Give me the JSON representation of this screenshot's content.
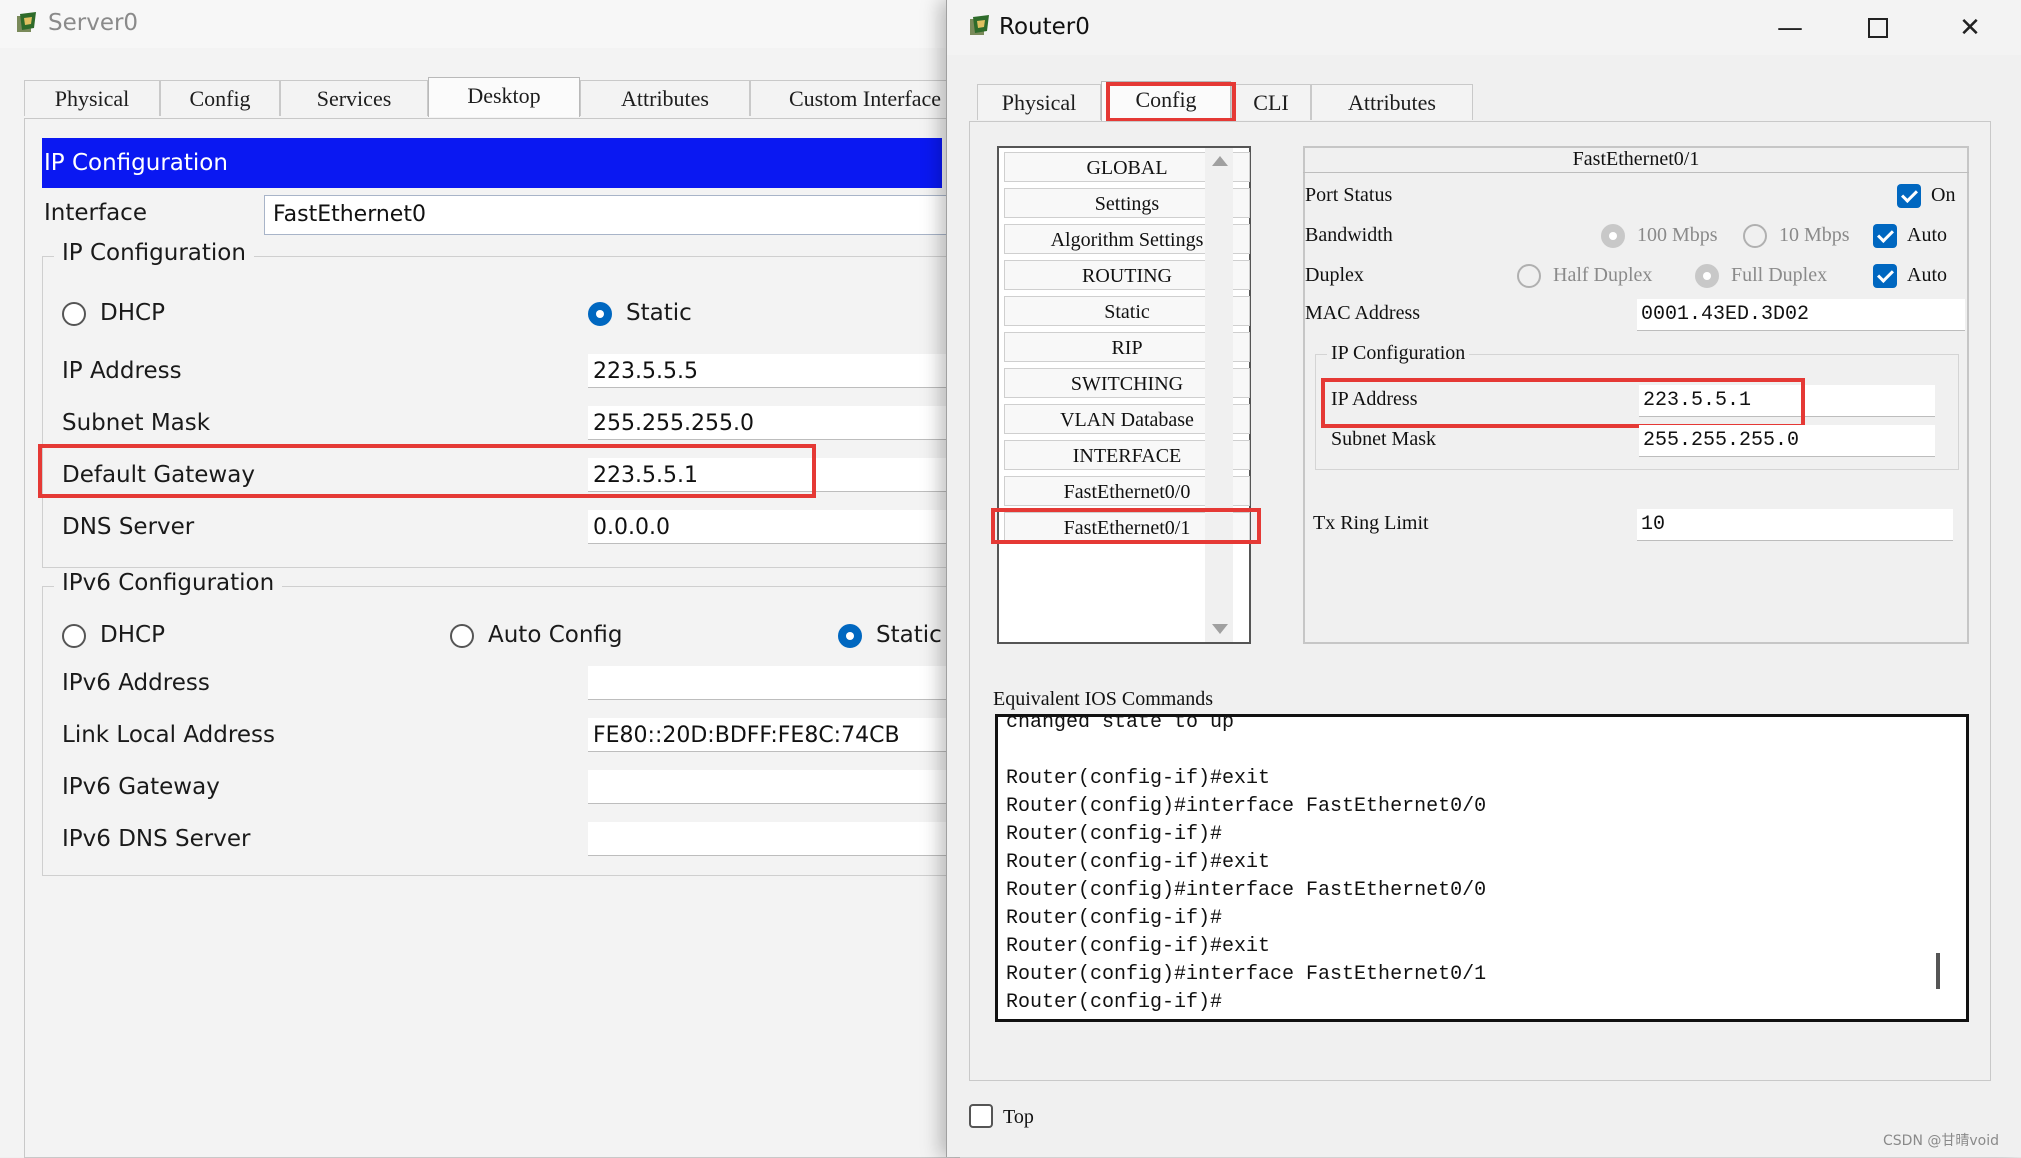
{
  "server": {
    "title": "Server0",
    "tabs": [
      "Physical",
      "Config",
      "Services",
      "Desktop",
      "Attributes",
      "Custom Interface"
    ],
    "active_tab": "Desktop",
    "ip_config_header": "IP Configuration",
    "interface_label": "Interface",
    "interface_value": "FastEthernet0",
    "ipv4_group_title": "IP Configuration",
    "dhcp_label": "DHCP",
    "static_label": "Static",
    "ipv4_mode": "Static",
    "ip_address_label": "IP Address",
    "ip_address": "223.5.5.5",
    "subnet_mask_label": "Subnet Mask",
    "subnet_mask": "255.255.255.0",
    "default_gateway_label": "Default Gateway",
    "default_gateway": "223.5.5.1",
    "dns_server_label": "DNS Server",
    "dns_server": "0.0.0.0",
    "ipv6_group_title": "IPv6 Configuration",
    "ipv6_dhcp_label": "DHCP",
    "ipv6_auto_label": "Auto Config",
    "ipv6_static_label": "Static",
    "ipv6_mode": "Static",
    "ipv6_address_label": "IPv6 Address",
    "ipv6_address": "",
    "link_local_label": "Link Local Address",
    "link_local": "FE80::20D:BDFF:FE8C:74CB",
    "ipv6_gateway_label": "IPv6 Gateway",
    "ipv6_gateway": "",
    "ipv6_dns_label": "IPv6 DNS Server",
    "ipv6_dns": ""
  },
  "router": {
    "title": "Router0",
    "tabs": [
      "Physical",
      "Config",
      "CLI",
      "Attributes"
    ],
    "active_tab": "Config",
    "left_list": [
      "GLOBAL",
      "Settings",
      "Algorithm Settings",
      "ROUTING",
      "Static",
      "RIP",
      "SWITCHING",
      "VLAN Database",
      "INTERFACE",
      "FastEthernet0/0",
      "FastEthernet0/1"
    ],
    "selected_item": "FastEthernet0/1",
    "interface_title": "FastEthernet0/1",
    "port_status_label": "Port Status",
    "port_on_label": "On",
    "port_on": true,
    "bandwidth_label": "Bandwidth",
    "bw_100_label": "100 Mbps",
    "bw_10_label": "10 Mbps",
    "bw_auto_label": "Auto",
    "bw_auto": true,
    "duplex_label": "Duplex",
    "half_duplex_label": "Half Duplex",
    "full_duplex_label": "Full Duplex",
    "duplex_auto_label": "Auto",
    "duplex_auto": true,
    "mac_label": "MAC Address",
    "mac_value": "0001.43ED.3D02",
    "ip_group_title": "IP Configuration",
    "ip_address_label": "IP Address",
    "ip_address": "223.5.5.1",
    "subnet_mask_label": "Subnet Mask",
    "subnet_mask": "255.255.255.0",
    "tx_ring_label": "Tx Ring Limit",
    "tx_ring_value": "10",
    "ios_label": "Equivalent IOS Commands",
    "ios_lines": [
      "changed state to up",
      "",
      "Router(config-if)#exit",
      "Router(config)#interface FastEthernet0/0",
      "Router(config-if)#",
      "Router(config-if)#exit",
      "Router(config)#interface FastEthernet0/0",
      "Router(config-if)#",
      "Router(config-if)#exit",
      "Router(config)#interface FastEthernet0/1",
      "Router(config-if)#"
    ],
    "top_label": "Top",
    "top_checked": false
  },
  "watermark": "CSDN @甘晴void"
}
